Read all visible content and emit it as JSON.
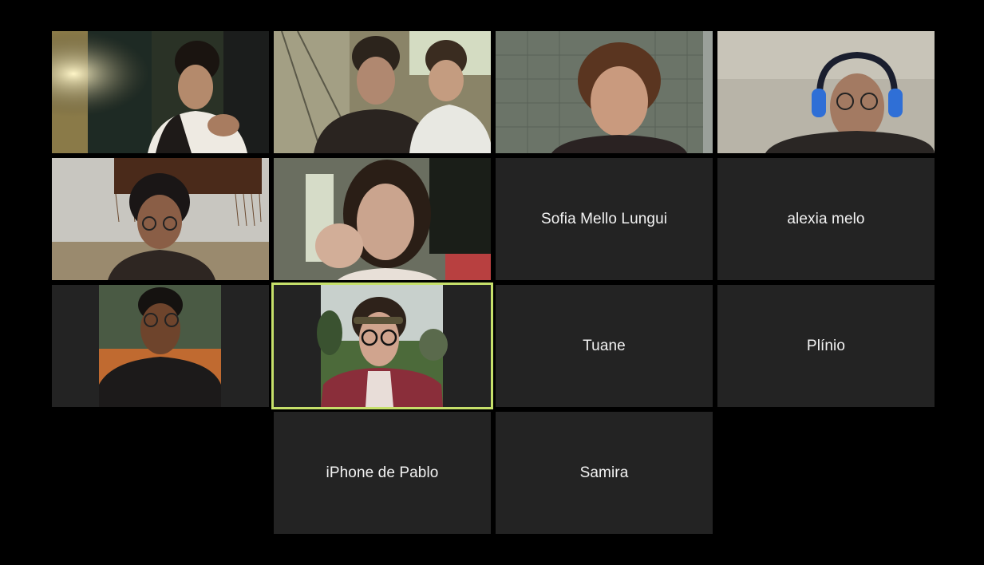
{
  "gallery": {
    "participants": [
      {
        "id": "p1",
        "has_video": true,
        "name": ""
      },
      {
        "id": "p2",
        "has_video": true,
        "name": ""
      },
      {
        "id": "p3",
        "has_video": true,
        "name": ""
      },
      {
        "id": "p4",
        "has_video": true,
        "name": ""
      },
      {
        "id": "p5",
        "has_video": true,
        "name": ""
      },
      {
        "id": "p6",
        "has_video": true,
        "name": ""
      },
      {
        "id": "p7",
        "has_video": false,
        "name": "Sofia Mello Lungui"
      },
      {
        "id": "p8",
        "has_video": false,
        "name": "alexia melo"
      },
      {
        "id": "p9",
        "has_video": true,
        "name": ""
      },
      {
        "id": "p10",
        "has_video": true,
        "name": "",
        "active_speaker": true
      },
      {
        "id": "p11",
        "has_video": false,
        "name": "Tuane"
      },
      {
        "id": "p12",
        "has_video": false,
        "name": "Plínio"
      },
      {
        "id": "p13",
        "has_video": false,
        "name": "iPhone de Pablo"
      },
      {
        "id": "p14",
        "has_video": false,
        "name": "Samira"
      }
    ]
  },
  "colors": {
    "background": "#000000",
    "tile_background": "#232323",
    "active_speaker_border": "#c6e06a"
  }
}
